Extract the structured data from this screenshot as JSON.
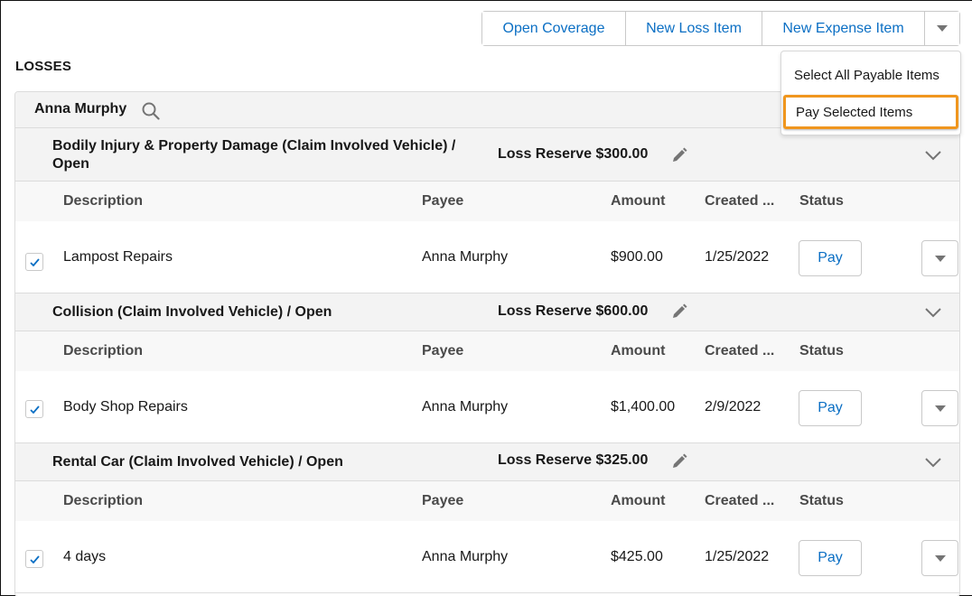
{
  "toolbar": {
    "buttons": [
      "Open Coverage",
      "New Loss Item",
      "New Expense Item"
    ],
    "more_icon": "caret-down-icon"
  },
  "dropdown_menu": {
    "items": [
      "Select All Payable Items",
      "Pay Selected Items"
    ],
    "highlighted": "Pay Selected Items"
  },
  "page": {
    "title": "LOSSES"
  },
  "payee_group": {
    "name": "Anna Murphy",
    "icon": "search-icon"
  },
  "columns": [
    "Description",
    "Payee",
    "Amount",
    "Created ...",
    "Status"
  ],
  "sections": [
    {
      "title_line1": "Bodily Injury & Property Damage (Claim Involved Vehicle) /",
      "title_line2": "Open",
      "reserve": "Loss Reserve $300.00",
      "items": [
        {
          "checked": true,
          "description": "Lampost Repairs",
          "payee": "Anna Murphy",
          "amount": "$900.00",
          "created": "1/25/2022",
          "action": "Pay"
        }
      ]
    },
    {
      "title_line1": "Collision (Claim Involved Vehicle) / Open",
      "title_line2": "",
      "reserve": "Loss Reserve $600.00",
      "items": [
        {
          "checked": true,
          "description": "Body Shop Repairs",
          "payee": "Anna Murphy",
          "amount": "$1,400.00",
          "created": "2/9/2022",
          "action": "Pay"
        }
      ]
    },
    {
      "title_line1": "Rental Car (Claim Involved Vehicle) / Open",
      "title_line2": "",
      "reserve": "Loss Reserve $325.00",
      "items": [
        {
          "checked": true,
          "description": "4 days",
          "payee": "Anna Murphy",
          "amount": "$425.00",
          "created": "1/25/2022",
          "action": "Pay"
        }
      ]
    }
  ],
  "colors": {
    "link_blue": "#0b6fc4",
    "highlight_orange": "#f0961e",
    "header_gray": "#f3f3f3"
  }
}
